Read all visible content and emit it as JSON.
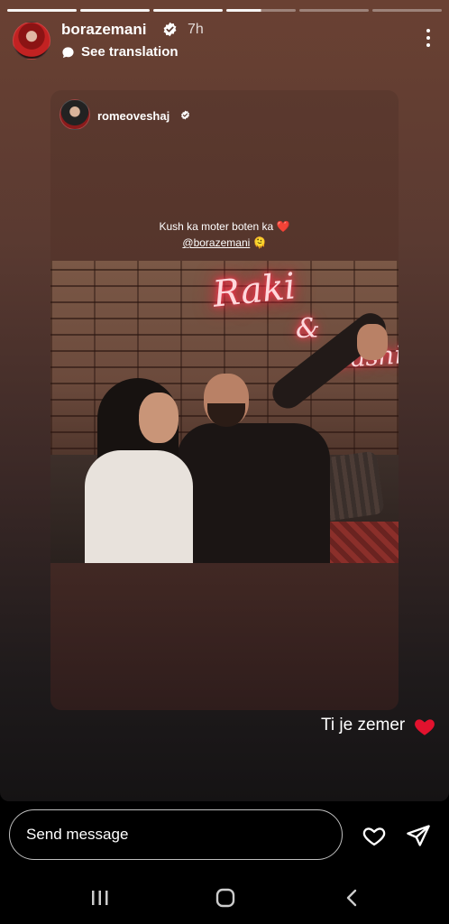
{
  "story": {
    "progress_segments": [
      "done",
      "done",
      "done",
      "active",
      "pending",
      "pending"
    ],
    "author": {
      "username": "borazemani",
      "verified": true,
      "time_ago": "7h"
    },
    "translation": {
      "label": "See translation"
    },
    "shared_post": {
      "username": "romeoveshaj",
      "verified": true,
      "caption_line1": "Kush ka moter boten ka",
      "caption_emoji1": "❤️",
      "mention": "@borazemani",
      "caption_emoji2": "🫠"
    },
    "reply": {
      "text": "Ti je zemer",
      "emoji": "heart"
    }
  },
  "composer": {
    "placeholder": "Send message",
    "like_icon": "heart-outline-icon",
    "send_icon": "paper-plane-icon"
  },
  "navbar": {
    "items": [
      "recents-icon",
      "home-icon",
      "back-icon"
    ]
  },
  "colors": {
    "heart_red": "#e2122e",
    "background": "#000000"
  }
}
